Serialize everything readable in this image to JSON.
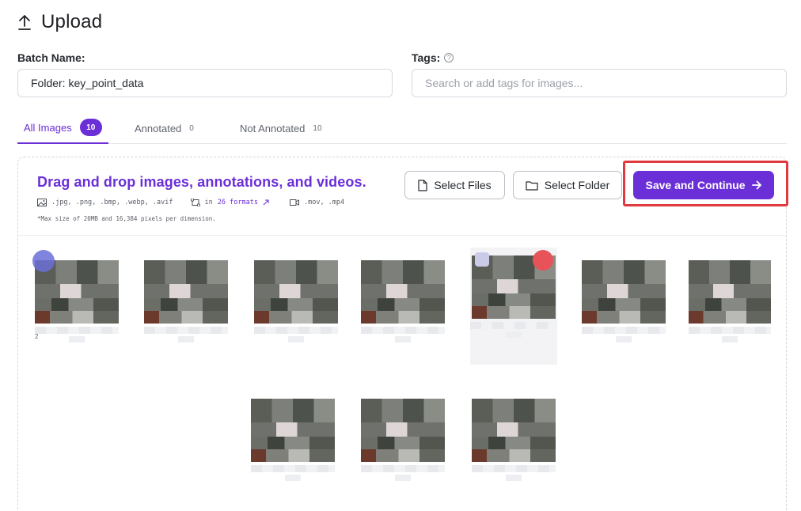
{
  "page": {
    "title": "Upload",
    "icon": "upload-icon"
  },
  "form": {
    "batch_label": "Batch Name:",
    "batch_value": "Folder: key_point_data",
    "tags_label": "Tags:",
    "tags_placeholder": "Search or add tags for images..."
  },
  "tabs": [
    {
      "label": "All Images",
      "count": "10",
      "active": true
    },
    {
      "label": "Annotated",
      "count": "0",
      "active": false
    },
    {
      "label": "Not Annotated",
      "count": "10",
      "active": false
    }
  ],
  "dropzone": {
    "title": "Drag and drop images, annotations, and videos.",
    "image_formats": ".jpg, .png, .bmp, .webp, .avif",
    "annotation_prefix": "in",
    "annotation_link": "26 formats",
    "video_formats": ".mov, .mp4",
    "max_note": "*Max size of 20MB and 16,384 pixels per dimension."
  },
  "buttons": {
    "select_files": "Select Files",
    "select_folder": "Select Folder",
    "save_continue": "Save and Continue"
  },
  "thumbnails": {
    "first_index": "2",
    "count": 10
  },
  "colors": {
    "accent": "#6b2fd8",
    "highlight": "#e0393e"
  }
}
